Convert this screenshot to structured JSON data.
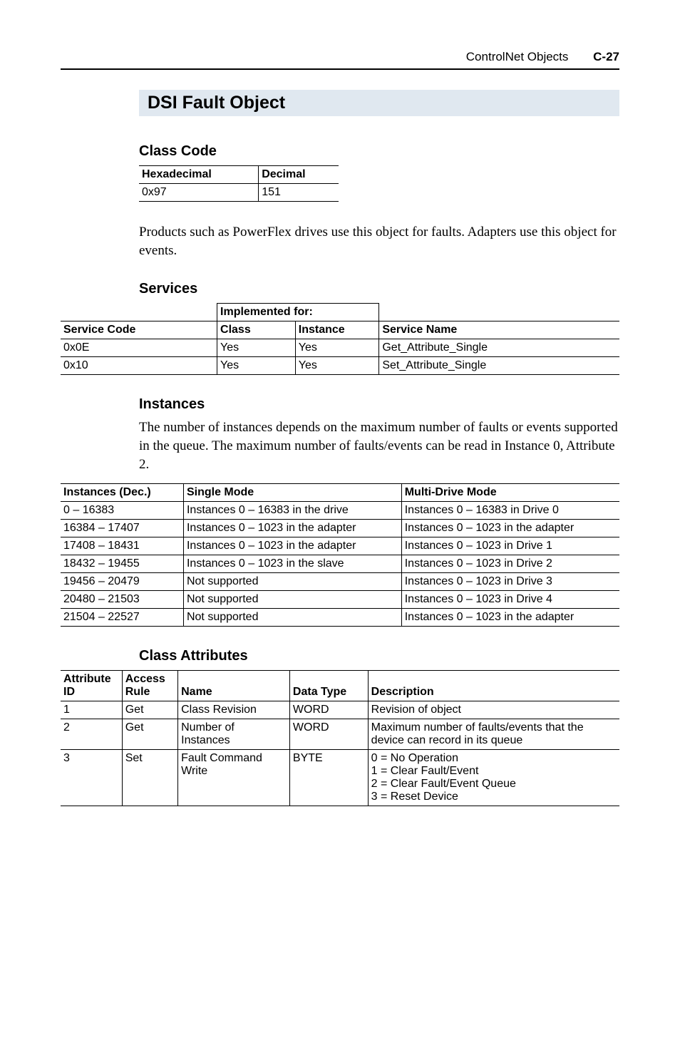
{
  "header": {
    "title": "ControlNet Objects",
    "pageno": "C-27"
  },
  "section_title": "DSI Fault Object",
  "classcode": {
    "heading": "Class Code",
    "headers": [
      "Hexadecimal",
      "Decimal"
    ],
    "row": [
      "0x97",
      "151"
    ]
  },
  "body1": "Products such as PowerFlex drives use this object for faults. Adapters use this object for events.",
  "services": {
    "heading": "Services",
    "group_header": "Implemented for:",
    "headers": [
      "Service Code",
      "Class",
      "Instance",
      "Service Name"
    ],
    "rows": [
      [
        "0x0E",
        "Yes",
        "Yes",
        "Get_Attribute_Single"
      ],
      [
        "0x10",
        "Yes",
        "Yes",
        "Set_Attribute_Single"
      ]
    ]
  },
  "instances": {
    "heading": "Instances",
    "body": "The number of instances depends on the maximum number of faults or events supported in the queue. The maximum number of faults/events can be read in Instance 0, Attribute 2.",
    "headers": [
      "Instances (Dec.)",
      "Single Mode",
      "Multi-Drive Mode"
    ],
    "rows": [
      [
        "0 – 16383",
        "Instances 0 – 16383 in the drive",
        "Instances 0 – 16383 in Drive 0"
      ],
      [
        "16384 – 17407",
        "Instances 0 – 1023 in the adapter",
        "Instances 0 – 1023 in the adapter"
      ],
      [
        "17408 – 18431",
        "Instances 0 – 1023 in the adapter",
        "Instances 0 – 1023 in Drive 1"
      ],
      [
        "18432 – 19455",
        "Instances 0 – 1023 in the slave",
        "Instances 0 – 1023 in Drive 2"
      ],
      [
        "19456 – 20479",
        "Not supported",
        "Instances 0 – 1023 in Drive 3"
      ],
      [
        "20480 – 21503",
        "Not supported",
        "Instances 0 – 1023 in Drive 4"
      ],
      [
        "21504 – 22527",
        "Not supported",
        "Instances 0 – 1023 in the adapter"
      ]
    ]
  },
  "attrs": {
    "heading": "Class Attributes",
    "headers": [
      "Attribute\nID",
      "Access\nRule",
      "Name",
      "Data Type",
      "Description"
    ],
    "rows": [
      [
        "1",
        "Get",
        "Class Revision",
        "WORD",
        "Revision of object"
      ],
      [
        "2",
        "Get",
        "Number of Instances",
        "WORD",
        "Maximum number of faults/events that the device can record in its queue"
      ],
      [
        "3",
        "Set",
        "Fault Command Write",
        "BYTE",
        "0 = No Operation\n1 = Clear Fault/Event\n2 = Clear Fault/Event Queue\n3 = Reset Device"
      ]
    ]
  }
}
